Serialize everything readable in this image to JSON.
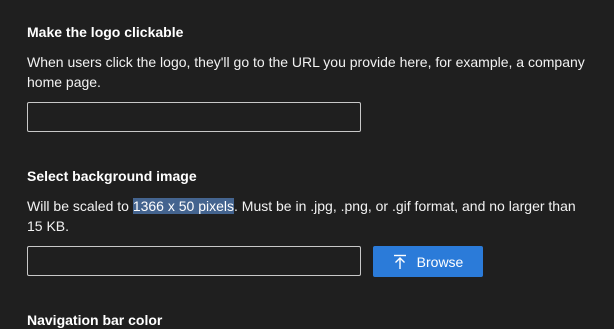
{
  "logo_link": {
    "title": "Make the logo clickable",
    "description": "When users click the logo, they'll go to the URL you provide here, for example, a company home page.",
    "url_value": ""
  },
  "background_image": {
    "title": "Select background image",
    "description_prefix": "Will be scaled to ",
    "description_highlight": "1366 x 50 pixels",
    "description_suffix": ". Must be in .jpg, .png, or .gif format, and no larger than 15 KB.",
    "file_value": "",
    "browse_label": "Browse",
    "browse_icon": "upload-icon"
  },
  "navigation_bar": {
    "title": "Navigation bar color"
  },
  "colors": {
    "background": "#1f1f1f",
    "accent": "#2b7bd9",
    "selection": "#44648f"
  }
}
